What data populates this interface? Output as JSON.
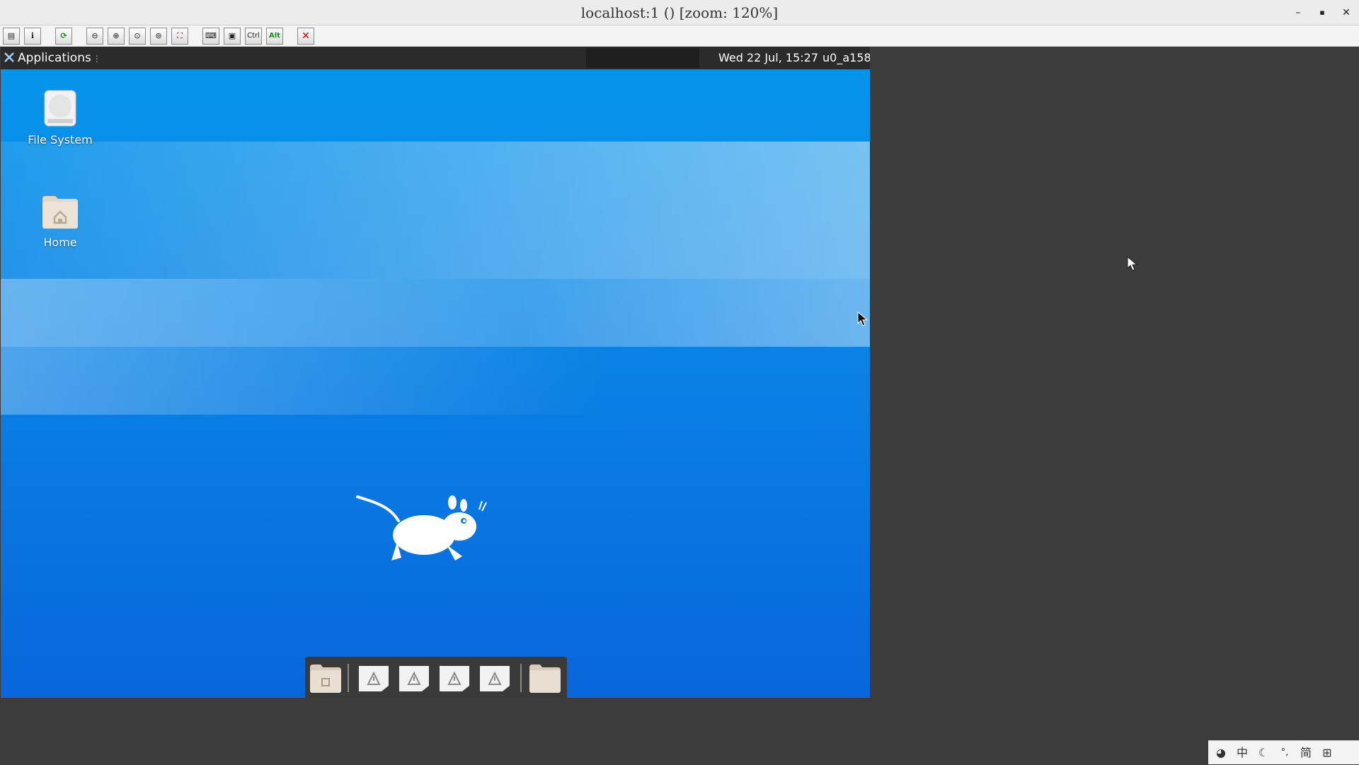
{
  "window": {
    "title": "localhost:1 () [zoom: 120%]",
    "minimize_label": "–",
    "maximize_label": "▪",
    "close_label": "✕"
  },
  "vnc_toolbar": {
    "ctrl_label": "Ctrl",
    "alt_label": "Alt",
    "buttons": [
      "options-icon",
      "info-icon",
      "refresh-icon",
      "zoom-out-icon",
      "zoom-in-icon",
      "zoom-reset-icon",
      "zoom-fit-icon",
      "fullscreen-icon",
      "ctrl-alt-del-icon",
      "screenshot-icon",
      "ctrl-key",
      "alt-key",
      "disconnect-icon"
    ]
  },
  "panel": {
    "applications_label": "Applications",
    "applications_dots": "⋮",
    "clock": "Wed 22 Jul, 15:27",
    "user": "u0_a158"
  },
  "desktop_icons": {
    "file_system_label": "File System",
    "home_label": "Home"
  },
  "dock": {
    "items": [
      "file-manager-icon",
      "warning-file-icon",
      "warning-file-icon",
      "warning-file-icon",
      "warning-file-icon",
      "folder-icon"
    ]
  },
  "ime_tray": {
    "chinese": "中",
    "punct": "°,",
    "simplified": "简"
  },
  "colors": {
    "desktop_top": "#0596ec",
    "desktop_bottom": "#0866dc",
    "panel": "#2b2b2b",
    "background": "#3c3c3c"
  }
}
